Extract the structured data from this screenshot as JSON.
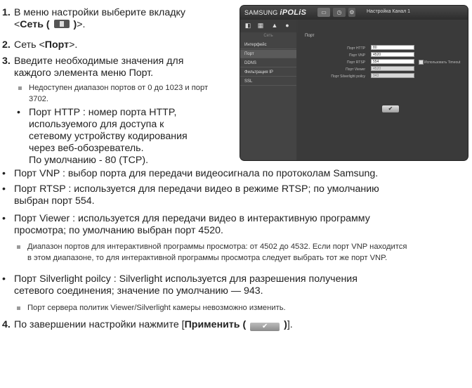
{
  "steps": [
    {
      "num": "1.",
      "line1": "В меню настройки выберите вкладку",
      "line2_prefix": "<",
      "line2_bold": "Сеть (",
      "line2_bold_end": ")",
      "line2_suffix": ">."
    },
    {
      "num": "2.",
      "text_prefix": "Сеть <",
      "text_bold": "Порт",
      "text_suffix": ">."
    },
    {
      "num": "3.",
      "line1": "Введите необходимые значения для",
      "line2": "каждого элемента меню Порт."
    },
    {
      "num": "4.",
      "text_prefix": "По завершении настройки нажмите [",
      "text_bold": "Применить (",
      "text_bold_end": ")",
      "text_suffix": "]."
    }
  ],
  "note1": {
    "line1": "Недоступен диапазон портов от 0 до 1023 и порт",
    "line2": "3702."
  },
  "bullets": {
    "http": [
      "Порт HTTP : номер порта HTTP,",
      "используемого для доступа к",
      "сетевому устройству кодирования",
      "через веб-обозреватель.",
      "По умолчанию - 80 (TCP)."
    ],
    "vnp": "Порт VNP : выбор порта для передачи видеосигнала по протоколам Samsung.",
    "rtsp": [
      "Порт RTSP : используется для передачи видео в режиме RTSP; по умолчанию",
      "выбран порт 554."
    ],
    "viewer": [
      "Порт Viewer : используется для передачи видео в интерактивную программу",
      "просмотра; по умолчанию выбран порт 4520."
    ],
    "silverlight": [
      "Порт Silverlight poilcy : Silverlight используется для разрешения получения",
      "сетевого соединения; значение по умолчанию — 943."
    ]
  },
  "note2": [
    "Диапазон портов для интерактивной программы просмотра: от 4502 до 4532. Если порт VNP находится",
    "в этом диапазоне, то для интерактивной программы просмотра следует выбрать тот же порт VNP."
  ],
  "note3": "Порт сервера политик Viewer/Silverlight камеры невозможно изменить.",
  "screenshot": {
    "brand_prefix": "SAMSUNG",
    "brand_logo": "iPOLiS",
    "title": "Настройка Канал 1",
    "side_label": "Сеть",
    "side_items": [
      "Интерфейс",
      "Порт",
      "DDNS",
      "Фильтрация IP",
      "SSL"
    ],
    "section": "Порт",
    "rows": [
      {
        "label": "Порт HTTP",
        "value": "80",
        "disabled": false
      },
      {
        "label": "Порт VNP",
        "value": "4520",
        "disabled": false
      },
      {
        "label": "Порт RTSP",
        "value": "554",
        "disabled": false
      },
      {
        "label": "Порт Viewer",
        "value": "4520",
        "disabled": true
      },
      {
        "label": "Порт Silverlight poilcy",
        "value": "943",
        "disabled": true
      }
    ],
    "rtsp_checkbox_label": "Использовать Timeout",
    "apply_glyph": "✔"
  },
  "icons": {
    "net_icon": "network-tab-icon",
    "apply_icon": "apply-check-icon"
  }
}
